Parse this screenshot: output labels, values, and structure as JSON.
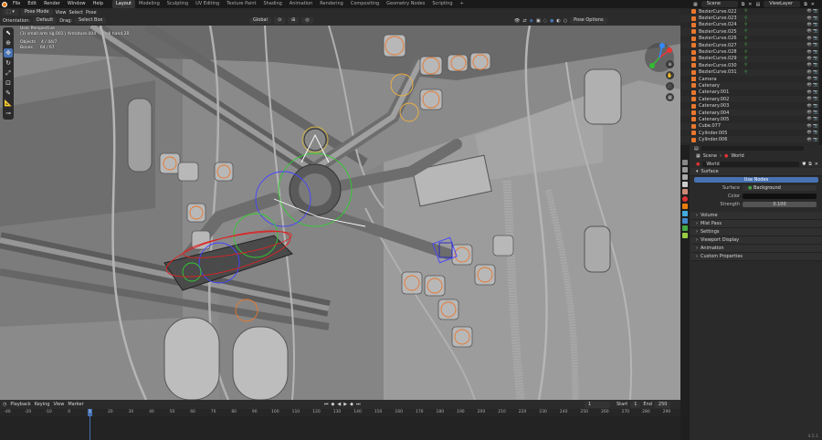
{
  "menu": [
    "File",
    "Edit",
    "Render",
    "Window",
    "Help"
  ],
  "workspaces": [
    "Layout",
    "Modeling",
    "Sculpting",
    "UV Editing",
    "Texture Paint",
    "Shading",
    "Animation",
    "Rendering",
    "Compositing",
    "Geometry Nodes",
    "Scripting"
  ],
  "workspace_active": "Layout",
  "add_workspace": "+",
  "scene_name": "Scene",
  "view_layer": "ViewLayer",
  "viewport_header": {
    "mode": "Pose Mode",
    "view": "View",
    "select": "Select",
    "pose": "Pose",
    "orientation_label": "Orientation:",
    "orientation": "Default",
    "drag_label": "Drag:",
    "drag": "Select Box",
    "transform": "Global",
    "pose_options": "Pose Options"
  },
  "viewport_overlay": {
    "perspective": "User Perspective",
    "context": "(1) small arm rig.001 | Armature.004 : small hand.2R",
    "objects_label": "Objects",
    "objects_value": "4 / 44/7",
    "bones_label": "Bones",
    "bones_value": "64 / 67"
  },
  "timeline": {
    "playback": "Playback",
    "keying": "Keying",
    "view": "View",
    "marker": "Marker",
    "current_frame": "1",
    "start_label": "Start",
    "start": "1",
    "end_label": "End",
    "end": "250",
    "ruler": [
      "-40",
      "-20",
      "-10",
      "0",
      "10",
      "20",
      "30",
      "40",
      "50",
      "60",
      "70",
      "80",
      "90",
      "100",
      "110",
      "120",
      "130",
      "140",
      "150",
      "160",
      "170",
      "180",
      "190",
      "200",
      "210",
      "220",
      "230",
      "240",
      "250",
      "260",
      "270",
      "280",
      "290"
    ]
  },
  "outliner_items": [
    {
      "name": "BezierCurve.022",
      "type": "curve"
    },
    {
      "name": "BezierCurve.023",
      "type": "curve"
    },
    {
      "name": "BezierCurve.024",
      "type": "curve"
    },
    {
      "name": "BezierCurve.025",
      "type": "curve"
    },
    {
      "name": "BezierCurve.026",
      "type": "curve"
    },
    {
      "name": "BezierCurve.027",
      "type": "curve"
    },
    {
      "name": "BezierCurve.028",
      "type": "curve"
    },
    {
      "name": "BezierCurve.029",
      "type": "curve"
    },
    {
      "name": "BezierCurve.030",
      "type": "curve"
    },
    {
      "name": "BezierCurve.031",
      "type": "curve"
    },
    {
      "name": "Camera",
      "type": "camera"
    },
    {
      "name": "Catenary",
      "type": "mesh"
    },
    {
      "name": "Catenary.001",
      "type": "mesh"
    },
    {
      "name": "Catenary.002",
      "type": "mesh"
    },
    {
      "name": "Catenary.003",
      "type": "mesh"
    },
    {
      "name": "Catenary.004",
      "type": "mesh"
    },
    {
      "name": "Catenary.005",
      "type": "mesh"
    },
    {
      "name": "Cube.077",
      "type": "mesh"
    },
    {
      "name": "Cylinder.005",
      "type": "mesh"
    },
    {
      "name": "Cylinder.006",
      "type": "mesh"
    }
  ],
  "properties": {
    "breadcrumb_scene": "Scene",
    "breadcrumb_world": "World",
    "world_name": "World",
    "surface_panel": "Surface",
    "use_nodes": "Use Nodes",
    "surface_label": "Surface",
    "surface_value": "Background",
    "color_label": "Color",
    "strength_label": "Strength",
    "strength_value": "0.100",
    "panels": [
      "Volume",
      "Mist Pass",
      "Settings",
      "Viewport Display",
      "Animation",
      "Custom Properties"
    ]
  },
  "version": "4.5.1",
  "colors": {
    "accent": "#4772b3",
    "bone_orange": "#e8772e",
    "viewport_bg": "#8d8d8d",
    "world_color": "#101010"
  }
}
